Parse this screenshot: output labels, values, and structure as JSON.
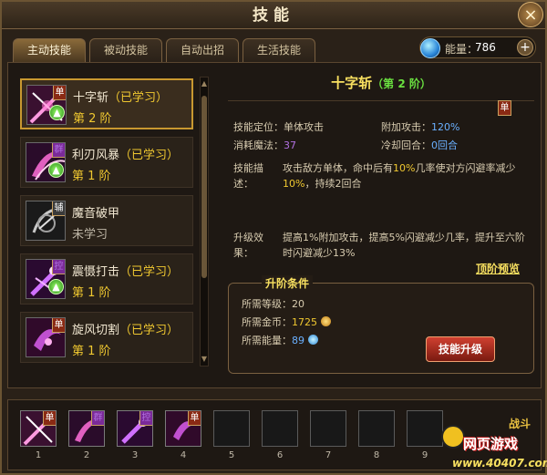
{
  "window": {
    "title": "技能"
  },
  "tabs": [
    {
      "label": "主动技能",
      "active": true
    },
    {
      "label": "被动技能",
      "active": false
    },
    {
      "label": "自动出招",
      "active": false
    },
    {
      "label": "生活技能",
      "active": false
    }
  ],
  "energy": {
    "label": "能量：",
    "value": "786",
    "plus": "+"
  },
  "skills": [
    {
      "name": "十字斩",
      "status": "（已学习）",
      "level": "第 2 阶",
      "tag": "单",
      "tag_color": "red",
      "icon": "cross-slash-icon",
      "can_upgrade": true
    },
    {
      "name": "利刃风暴",
      "status": "（已学习）",
      "level": "第 1 阶",
      "tag": "群",
      "tag_color": "purple",
      "icon": "blade-storm-icon",
      "can_upgrade": true
    },
    {
      "name": "魔音破甲",
      "status": "",
      "level": "未学习",
      "tag": "辅",
      "tag_color": "gray",
      "icon": "sonic-break-icon",
      "can_upgrade": false
    },
    {
      "name": "震慑打击",
      "status": "（已学习）",
      "level": "第 1 阶",
      "tag": "控",
      "tag_color": "purple",
      "icon": "stun-strike-icon",
      "can_upgrade": true
    },
    {
      "name": "旋风切割",
      "status": "（已学习）",
      "level": "第 1 阶",
      "tag": "单",
      "tag_color": "red",
      "icon": "whirlwind-cut-icon",
      "can_upgrade": false
    }
  ],
  "detail": {
    "name": "十字斩",
    "level": "（第 2 阶）",
    "tag": "单",
    "position_label": "技能定位：",
    "position_value": "单体攻击",
    "extra_attack_label": "附加攻击：",
    "extra_attack_value": "120%",
    "mana_label": "消耗魔法：",
    "mana_value": "37",
    "cooldown_label": "冷却回合：",
    "cooldown_value": "0回合",
    "desc_label": "技能描述：",
    "desc_parts": [
      "攻击敌方单体，命中后有",
      "10%",
      "几率使对方闪避率减少",
      "10%",
      "，持续2回合"
    ],
    "upgrade_label": "升级效果：",
    "upgrade_text": "提高1%附加攻击，提高5%闪避减少几率，提升至六阶时闪避减少13%",
    "preview_link": "顶阶预览"
  },
  "requirements": {
    "title": "升阶条件",
    "level_label": "所需等级：",
    "level_value": "20",
    "gold_label": "所需金币：",
    "gold_value": "1725",
    "energy_label": "所需能量：",
    "energy_value": "89",
    "button": "技能升级"
  },
  "hotbar": {
    "slots": [
      {
        "num": "1",
        "filled": true,
        "tag": "单",
        "tag_color": "red",
        "icon": "cross-slash-icon"
      },
      {
        "num": "2",
        "filled": true,
        "tag": "群",
        "tag_color": "purple",
        "icon": "blade-storm-icon"
      },
      {
        "num": "3",
        "filled": true,
        "tag": "控",
        "tag_color": "purple",
        "icon": "stun-strike-icon"
      },
      {
        "num": "4",
        "filled": true,
        "tag": "单",
        "tag_color": "red",
        "icon": "whirlwind-cut-icon"
      },
      {
        "num": "5",
        "filled": false
      },
      {
        "num": "6",
        "filled": false
      },
      {
        "num": "7",
        "filled": false
      },
      {
        "num": "8",
        "filled": false
      },
      {
        "num": "9",
        "filled": false
      }
    ]
  },
  "branding": {
    "top": "战斗",
    "middle": "网页游戏",
    "bottom": "www.40407.com"
  },
  "colors": {
    "gold": "#f0c830",
    "blue": "#6ab0ff",
    "purple": "#b070e0",
    "green": "#6ae040"
  }
}
